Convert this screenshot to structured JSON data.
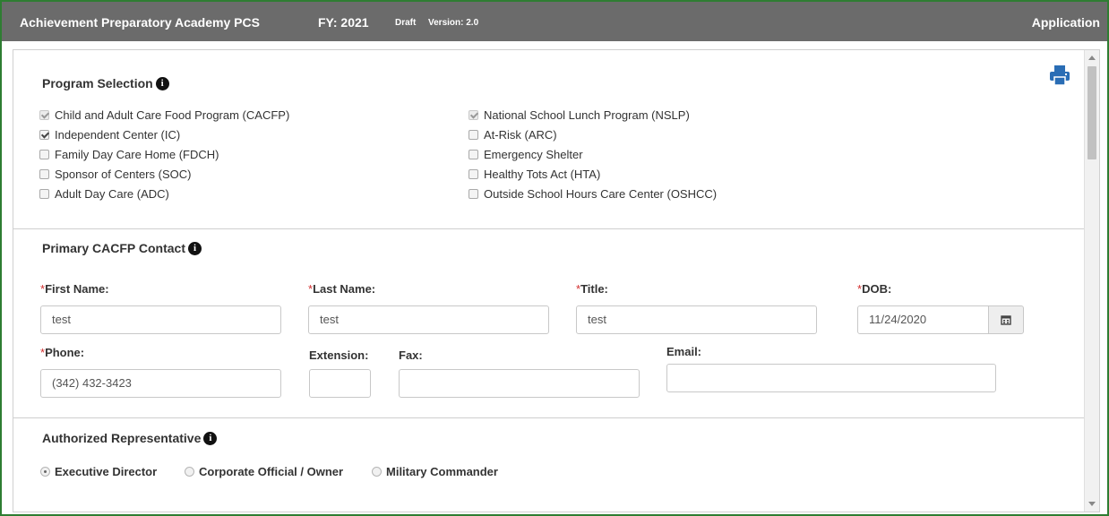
{
  "header": {
    "org": "Achievement Preparatory Academy PCS",
    "fy": "FY: 2021",
    "status": "Draft",
    "version": "Version: 2.0",
    "section": "Application"
  },
  "colors": {
    "header_bg": "#6b6b6b",
    "frame": "#2e7d32",
    "printer": "#2a6db5",
    "required": "#d32f2f"
  },
  "program_selection": {
    "title": "Program Selection",
    "left": [
      {
        "label": "Child and Adult Care Food Program (CACFP)",
        "checked": true,
        "disabled": true
      },
      {
        "label": "Independent Center (IC)",
        "checked": true,
        "disabled": false
      },
      {
        "label": "Family Day Care Home (FDCH)",
        "checked": false,
        "disabled": false
      },
      {
        "label": "Sponsor of Centers (SOC)",
        "checked": false,
        "disabled": false
      },
      {
        "label": "Adult Day Care (ADC)",
        "checked": false,
        "disabled": false
      }
    ],
    "right": [
      {
        "label": "National School Lunch Program (NSLP)",
        "checked": true,
        "disabled": true
      },
      {
        "label": "At-Risk (ARC)",
        "checked": false,
        "disabled": false
      },
      {
        "label": "Emergency Shelter",
        "checked": false,
        "disabled": false
      },
      {
        "label": "Healthy Tots Act (HTA)",
        "checked": false,
        "disabled": false
      },
      {
        "label": "Outside School Hours Care Center (OSHCC)",
        "checked": false,
        "disabled": false
      }
    ]
  },
  "contact": {
    "title": "Primary CACFP Contact",
    "required_mark": "*",
    "first_name_label": "First Name:",
    "first_name_value": "test",
    "last_name_label": "Last Name:",
    "last_name_value": "test",
    "title_label": "Title:",
    "title_value": "test",
    "dob_label": "DOB:",
    "dob_value": "11/24/2020",
    "phone_label": "Phone:",
    "phone_value": "(342) 432-3423",
    "extension_label": "Extension:",
    "extension_value": "",
    "fax_label": "Fax:",
    "fax_value": "",
    "email_label": "Email:",
    "email_value": ""
  },
  "representative": {
    "title": "Authorized Representative",
    "options": [
      {
        "label": "Executive Director",
        "selected": true
      },
      {
        "label": "Corporate Official / Owner",
        "selected": false
      },
      {
        "label": "Military Commander",
        "selected": false
      }
    ]
  },
  "icons": {
    "info": "info-circle-icon",
    "print": "printer-icon",
    "calendar": "calendar-icon"
  }
}
